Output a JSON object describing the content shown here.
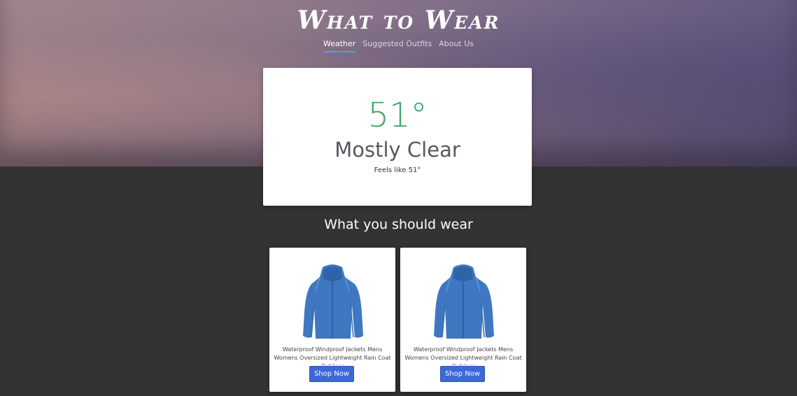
{
  "header": {
    "title": "What to Wear",
    "nav": [
      {
        "label": "Weather",
        "active": true
      },
      {
        "label": "Suggested Outfits",
        "active": false
      },
      {
        "label": "About Us",
        "active": false
      }
    ]
  },
  "weather": {
    "temperature": "51°",
    "condition": "Mostly Clear",
    "feels_like": "Feels like 51°"
  },
  "suggestions": {
    "heading": "What you should wear",
    "products": [
      {
        "name": "Waterproof Windproof Jackets Mens Womens Oversized Lightweight Rain Coat Outdoor",
        "button_label": "Shop Now",
        "image_icon": "blue-hooded-jacket"
      },
      {
        "name": "Waterproof Windproof Jackets Mens Womens Oversized Lightweight Rain Coat Outdoor",
        "button_label": "Shop Now",
        "image_icon": "blue-hooded-jacket"
      }
    ]
  },
  "colors": {
    "temperature": "#3fa66a",
    "button": "#3d68d8",
    "nav_underline": "#4aa3df",
    "background": "#333333"
  }
}
